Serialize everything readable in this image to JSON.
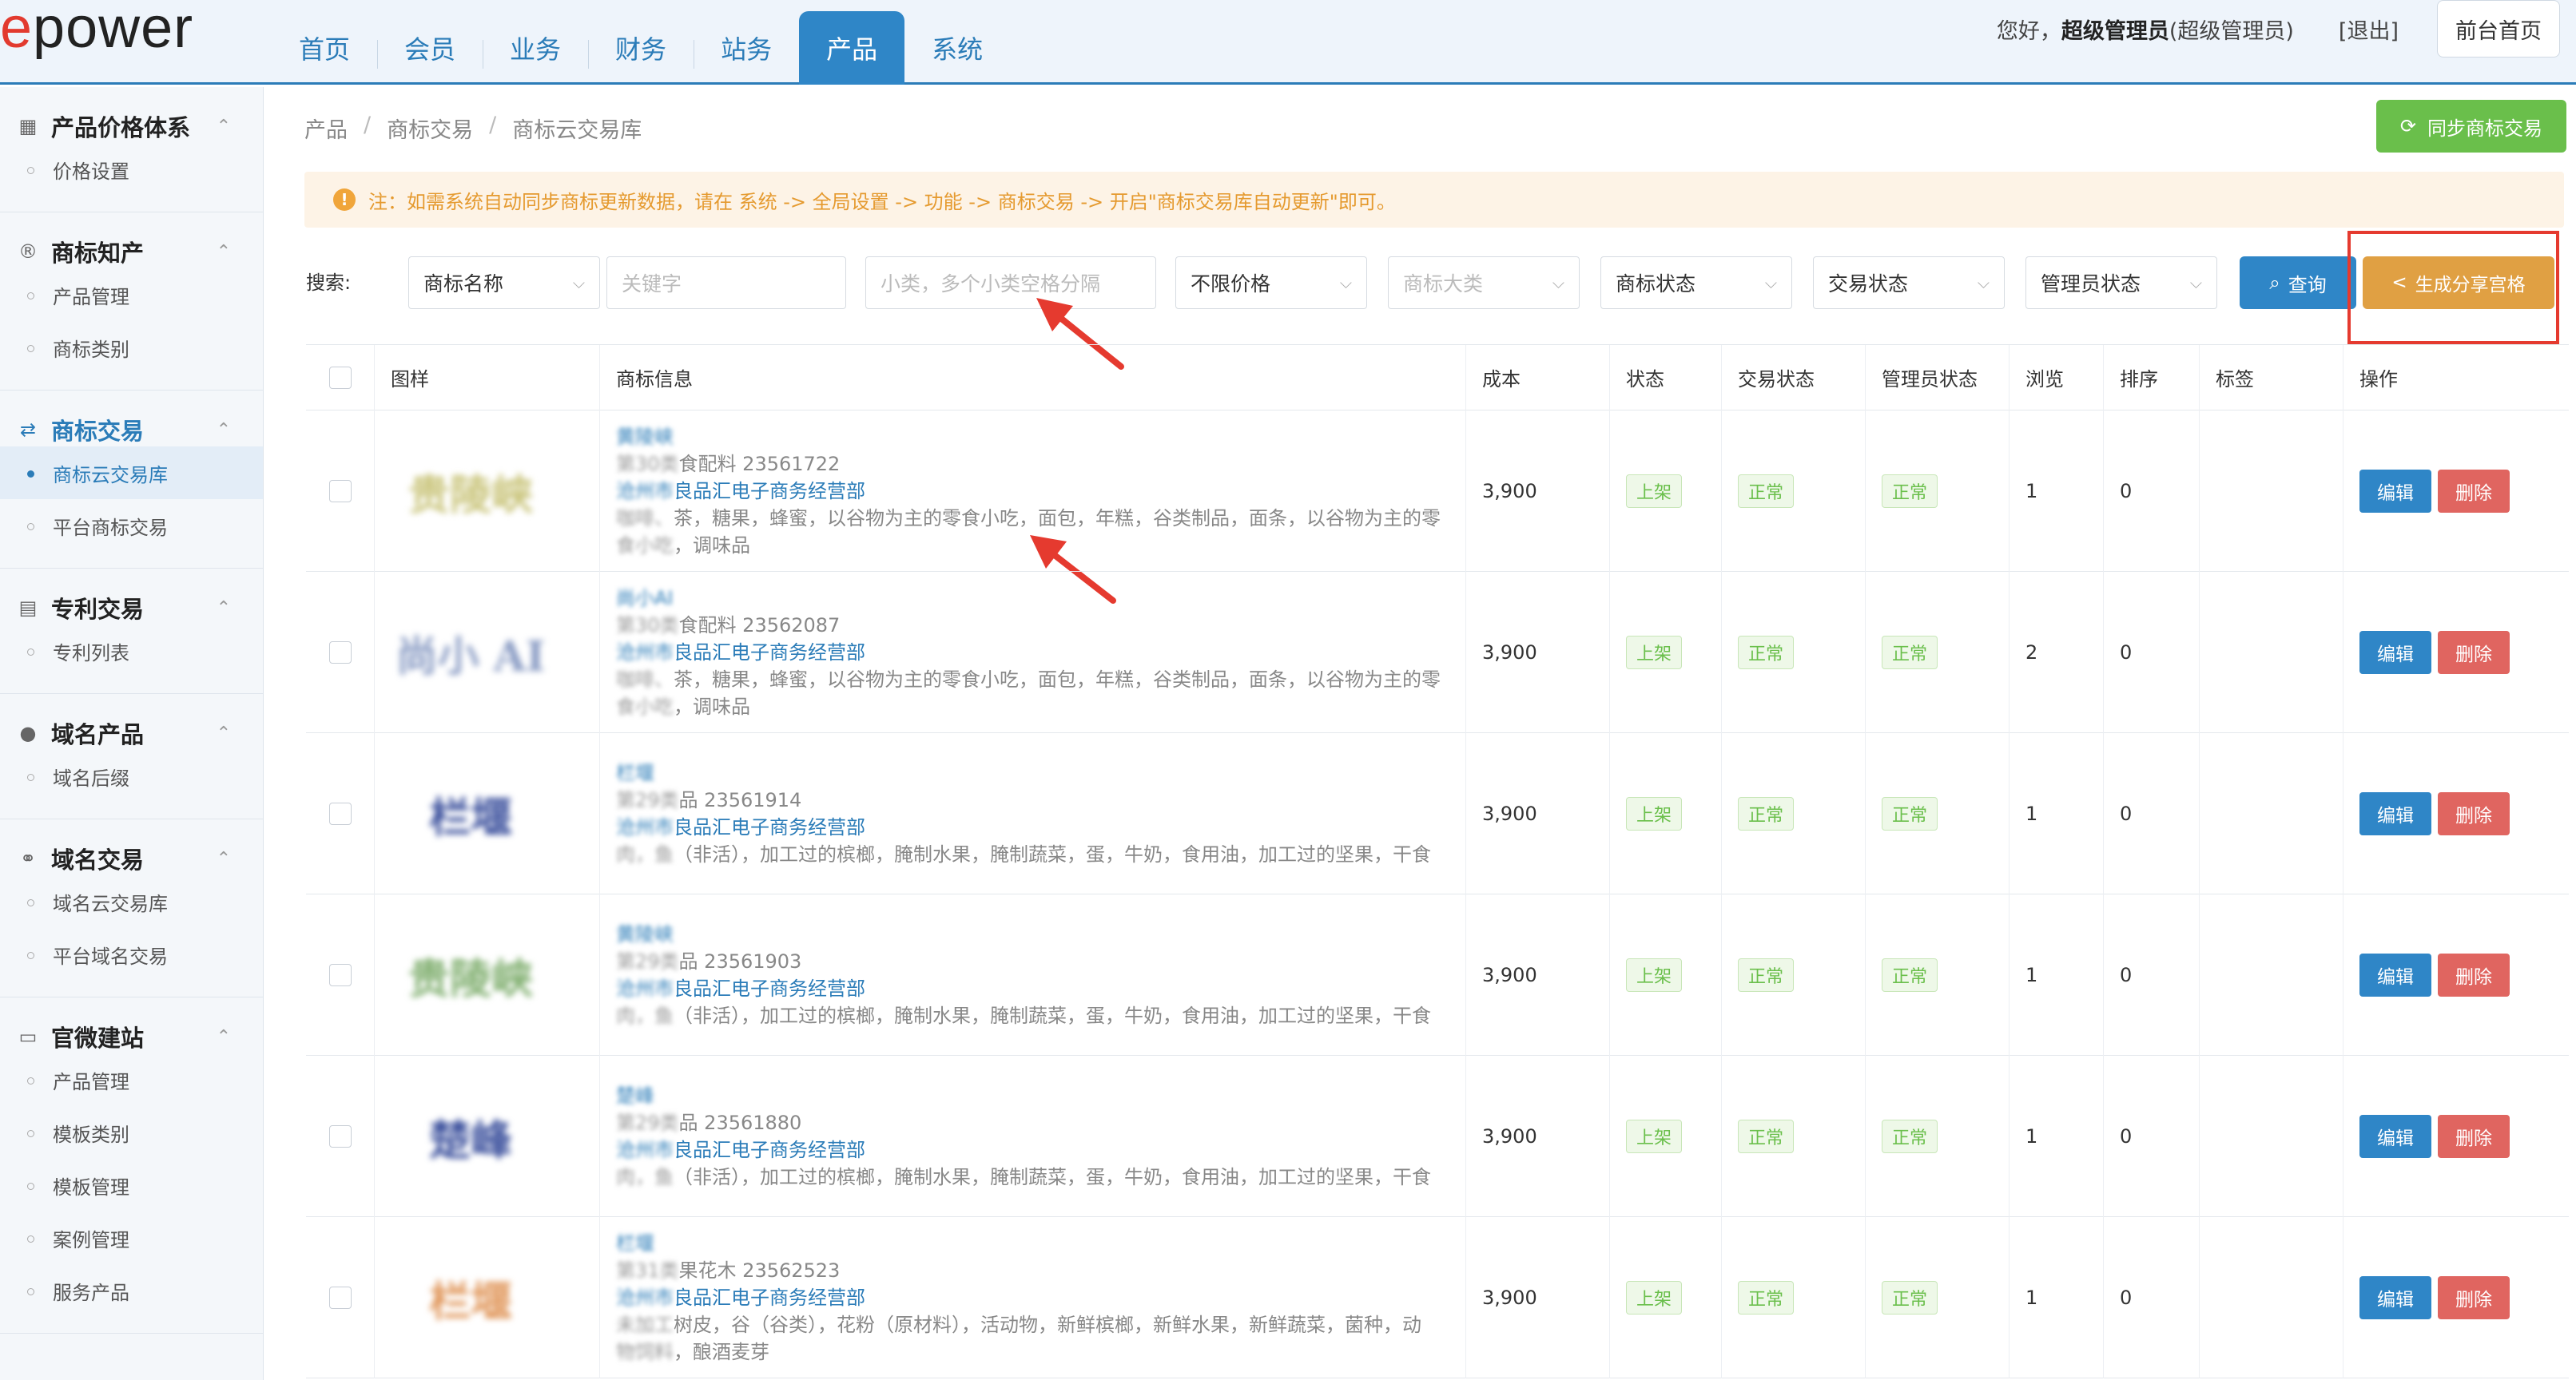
{
  "brand": {
    "logo_e": "e",
    "logo_rest": "power"
  },
  "nav": {
    "tabs": [
      "首页",
      "会员",
      "业务",
      "财务",
      "站务",
      "产品",
      "系统"
    ],
    "active_index": 5
  },
  "user": {
    "greet_prefix": "您好，",
    "name": "超级管理员",
    "role": "(超级管理员)",
    "logout": "[退出]",
    "front_btn": "前台首页"
  },
  "sidebar": {
    "groups": [
      {
        "title": "产品价格体系",
        "icon": "calculator-icon",
        "glyph": "▦",
        "items": [
          "价格设置"
        ],
        "active": false
      },
      {
        "title": "商标知产",
        "icon": "registered-icon",
        "glyph": "®",
        "items": [
          "产品管理",
          "商标类别"
        ],
        "active": false
      },
      {
        "title": "商标交易",
        "icon": "handshake-icon",
        "glyph": "⇄",
        "items": [
          "商标云交易库",
          "平台商标交易"
        ],
        "active": true,
        "active_item": 0
      },
      {
        "title": "专利交易",
        "icon": "document-icon",
        "glyph": "▤",
        "items": [
          "专利列表"
        ],
        "active": false
      },
      {
        "title": "域名产品",
        "icon": "globe-icon",
        "glyph": "●",
        "items": [
          "域名后缀"
        ],
        "active": false
      },
      {
        "title": "域名交易",
        "icon": "link-icon",
        "glyph": "⚭",
        "items": [
          "域名云交易库",
          "平台域名交易"
        ],
        "active": false
      },
      {
        "title": "官微建站",
        "icon": "monitor-icon",
        "glyph": "▭",
        "items": [
          "产品管理",
          "模板类别",
          "模板管理",
          "案例管理",
          "服务产品"
        ],
        "active": false
      }
    ]
  },
  "breadcrumb": [
    "产品",
    "商标交易",
    "商标云交易库"
  ],
  "sync_button": "同步商标交易",
  "notice": "注：如需系统自动同步商标更新数据，请在 系统 -> 全局设置 -> 功能 -> 商标交易 -> 开启\"商标交易库自动更新\"即可。",
  "search": {
    "label": "搜索:",
    "field_select": "商标名称",
    "keyword_placeholder": "关键字",
    "subclass_placeholder": "小类，多个小类空格分隔",
    "price_select": "不限价格",
    "category_placeholder": "商标大类",
    "status_select": "商标状态",
    "trade_status_select": "交易状态",
    "admin_status_select": "管理员状态",
    "query_button": "查询",
    "generate_button": "生成分享宫格"
  },
  "table": {
    "headers": [
      "图样",
      "商标信息",
      "成本",
      "状态",
      "交易状态",
      "管理员状态",
      "浏览",
      "排序",
      "标签",
      "操作"
    ],
    "rows": [
      {
        "logo_text": "贵陵峡",
        "logo_color": "#c9c47a",
        "name": "黄陵峡",
        "cls_prefix": "第30类",
        "cls": "食配料 23561722",
        "owner_prefix": "沧州市",
        "owner": "良品汇电子商务经营部",
        "desc_prefix": "咖啡、",
        "desc": "茶，糖果，蜂蜜，以谷物为主的零食小吃，面包，年糕，谷类制品，面条，以谷物为主的零",
        "desc2_prefix": "食小吃",
        "desc2": "，调味品",
        "cost": "3,900",
        "status": "上架",
        "trade": "正常",
        "admin": "正常",
        "views": "1",
        "order": "0"
      },
      {
        "logo_text": "尚小 AI",
        "logo_color": "#8a9cc4",
        "name": "尚小AI",
        "cls_prefix": "第30类",
        "cls": "食配料 23562087",
        "owner_prefix": "沧州市",
        "owner": "良品汇电子商务经营部",
        "desc_prefix": "咖啡、",
        "desc": "茶，糖果，蜂蜜，以谷物为主的零食小吃，面包，年糕，谷类制品，面条，以谷物为主的零",
        "desc2_prefix": "食小吃",
        "desc2": "，调味品",
        "cost": "3,900",
        "status": "上架",
        "trade": "正常",
        "admin": "正常",
        "views": "2",
        "order": "0"
      },
      {
        "logo_text": "栏堰",
        "logo_color": "#3a4f9c",
        "name": "栏堰",
        "cls_prefix": "第29类",
        "cls": "品 23561914",
        "owner_prefix": "沧州市",
        "owner": "良品汇电子商务经营部",
        "desc_prefix": "肉，鱼",
        "desc": "（非活），加工过的槟榔，腌制水果，腌制蔬菜，蛋，牛奶，食用油，加工过的坚果，干食",
        "desc2_prefix": "",
        "desc2": "",
        "cost": "3,900",
        "status": "上架",
        "trade": "正常",
        "admin": "正常",
        "views": "1",
        "order": "0"
      },
      {
        "logo_text": "贵陵峡",
        "logo_color": "#7fae6e",
        "name": "黄陵峡",
        "cls_prefix": "第29类",
        "cls": "品 23561903",
        "owner_prefix": "沧州市",
        "owner": "良品汇电子商务经营部",
        "desc_prefix": "肉，鱼",
        "desc": "（非活），加工过的槟榔，腌制水果，腌制蔬菜，蛋，牛奶，食用油，加工过的坚果，干食",
        "desc2_prefix": "",
        "desc2": "",
        "cost": "3,900",
        "status": "上架",
        "trade": "正常",
        "admin": "正常",
        "views": "1",
        "order": "0"
      },
      {
        "logo_text": "楚峰",
        "logo_color": "#3a4f9c",
        "name": "楚峰",
        "cls_prefix": "第29类",
        "cls": "品 23561880",
        "owner_prefix": "沧州市",
        "owner": "良品汇电子商务经营部",
        "desc_prefix": "肉，鱼",
        "desc": "（非活），加工过的槟榔，腌制水果，腌制蔬菜，蛋，牛奶，食用油，加工过的坚果，干食",
        "desc2_prefix": "",
        "desc2": "",
        "cost": "3,900",
        "status": "上架",
        "trade": "正常",
        "admin": "正常",
        "views": "1",
        "order": "0"
      },
      {
        "logo_text": "栏堰",
        "logo_color": "#e0965a",
        "name": "栏堰",
        "cls_prefix": "第31类",
        "cls": "果花木 23562523",
        "owner_prefix": "沧州市",
        "owner": "良品汇电子商务经营部",
        "desc_prefix": "未加工",
        "desc": "树皮，谷（谷类），花粉（原材料），活动物，新鲜槟榔，新鲜水果，新鲜蔬菜，菌种，动",
        "desc2_prefix": "物饲料",
        "desc2": "，酿酒麦芽",
        "cost": "3,900",
        "status": "上架",
        "trade": "正常",
        "admin": "正常",
        "views": "1",
        "order": "0"
      }
    ],
    "edit_label": "编辑",
    "delete_label": "删除"
  }
}
